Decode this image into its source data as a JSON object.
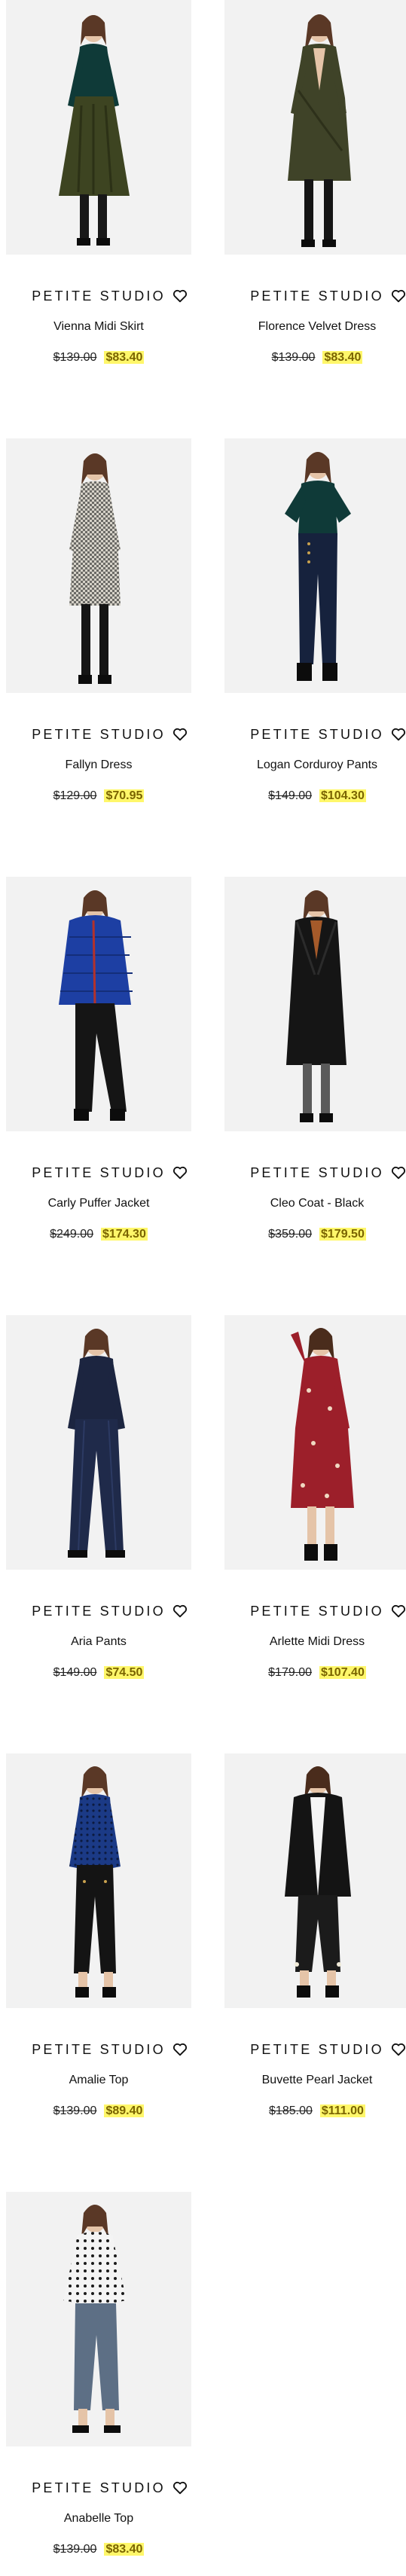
{
  "colors": {
    "background": "#ffffff",
    "photo_bg": "#f1f1f1",
    "sale_highlight": "#fff76a",
    "sale_text": "#7a6400"
  },
  "products": [
    {
      "brand": "PETITE STUDIO",
      "name": "Vienna Midi Skirt",
      "original_price": "$139.00",
      "sale_price": "$83.40",
      "outfit": "dark green turtleneck top with pleated olive velvet midi skirt",
      "icon": "heart-icon"
    },
    {
      "brand": "PETITE STUDIO",
      "name": "Florence Velvet Dress",
      "original_price": "$139.00",
      "sale_price": "$83.40",
      "outfit": "olive velvet wrap dress with black tights",
      "icon": "heart-icon"
    },
    {
      "brand": "PETITE STUDIO",
      "name": "Fallyn Dress",
      "original_price": "$129.00",
      "sale_price": "$70.95",
      "outfit": "grey houndstooth long sleeve dress",
      "icon": "heart-icon"
    },
    {
      "brand": "PETITE STUDIO",
      "name": "Logan Corduroy Pants",
      "original_price": "$149.00",
      "sale_price": "$104.30",
      "outfit": "dark green top with navy corduroy pants",
      "icon": "heart-icon"
    },
    {
      "brand": "PETITE STUDIO",
      "name": "Carly Puffer Jacket",
      "original_price": "$249.00",
      "sale_price": "$174.30",
      "outfit": "royal blue puffer jacket with black flared pants",
      "icon": "heart-icon"
    },
    {
      "brand": "PETITE STUDIO",
      "name": "Cleo Coat - Black",
      "original_price": "$359.00",
      "sale_price": "$179.50",
      "outfit": "long black coat with grey tights",
      "icon": "heart-icon"
    },
    {
      "brand": "PETITE STUDIO",
      "name": "Aria Pants",
      "original_price": "$149.00",
      "sale_price": "$74.50",
      "outfit": "navy blouse with navy wide leg pants",
      "icon": "heart-icon"
    },
    {
      "brand": "PETITE STUDIO",
      "name": "Arlette Midi Dress",
      "original_price": "$179.00",
      "sale_price": "$107.40",
      "outfit": "red floral midi dress",
      "icon": "heart-icon"
    },
    {
      "brand": "PETITE STUDIO",
      "name": "Amalie Top",
      "original_price": "$139.00",
      "sale_price": "$89.40",
      "outfit": "blue patterned top with black cropped pants",
      "icon": "heart-icon"
    },
    {
      "brand": "PETITE STUDIO",
      "name": "Buvette Pearl Jacket",
      "original_price": "$185.00",
      "sale_price": "$111.00",
      "outfit": "black jacket with cropped black pants",
      "icon": "heart-icon"
    },
    {
      "brand": "PETITE STUDIO",
      "name": "Anabelle Top",
      "original_price": "$139.00",
      "sale_price": "$83.40",
      "outfit": "white polka dot top with grey cropped jeans",
      "icon": "heart-icon"
    }
  ]
}
